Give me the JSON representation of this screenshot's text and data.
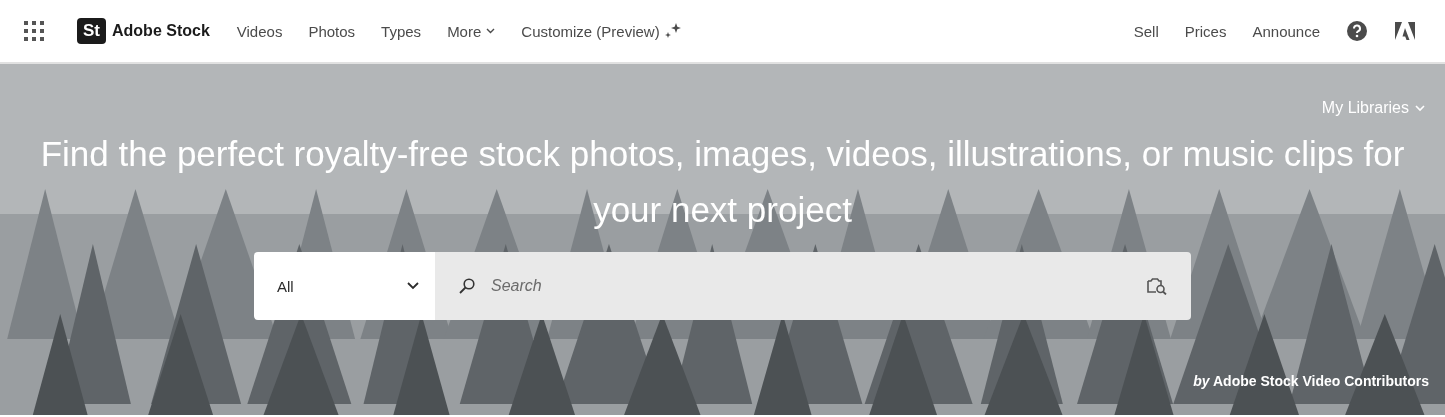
{
  "header": {
    "logo_mark": "St",
    "logo_text": "Adobe Stock",
    "nav": [
      {
        "label": "Videos",
        "kind": "link"
      },
      {
        "label": "Photos",
        "kind": "link"
      },
      {
        "label": "Types",
        "kind": "link"
      },
      {
        "label": "More",
        "kind": "dropdown"
      },
      {
        "label": "Customize (Preview)",
        "kind": "sparkle"
      }
    ],
    "right_links": [
      "Sell",
      "Prices",
      "Announce"
    ]
  },
  "hero": {
    "kind": "picture",
    "libraries": "My Libraries",
    "headline": "Find the perfect royalty-free stock photos, images, videos, illustrations, or music clips for your next project",
    "search": {
      "category": "All",
      "placeholder": "Search"
    },
    "credit": "*by* Adobe Stock Video Contributors"
  }
}
